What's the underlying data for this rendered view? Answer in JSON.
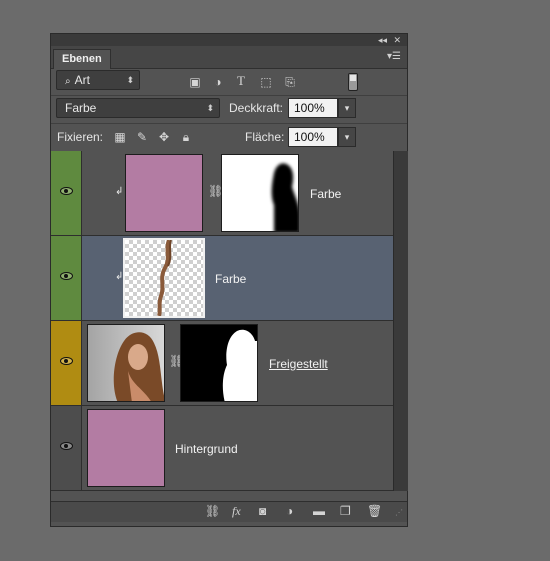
{
  "panel": {
    "tab_label": "Ebenen",
    "collapse_icon": "collapse-icon",
    "close_icon": "close-icon",
    "menu_icon": "panel-menu-icon"
  },
  "filter": {
    "kind_label": "Art",
    "icons": [
      "image-filter-icon",
      "adjustment-filter-icon",
      "type-filter-icon",
      "shape-filter-icon",
      "smartobject-filter-icon"
    ],
    "type_glyph": "T"
  },
  "blend": {
    "mode": "Farbe",
    "opacity_label": "Deckkraft:",
    "opacity_value": "100%"
  },
  "lock": {
    "label": "Fixieren:",
    "fill_label": "Fläche:",
    "fill_value": "100%"
  },
  "layers": [
    {
      "name": "Farbe",
      "color_tag": "#5a8a3a",
      "visible": true,
      "clipped": true,
      "thumb": "#b37ca3",
      "has_mask": true,
      "selected": false
    },
    {
      "name": "Farbe",
      "color_tag": "#5a8a3a",
      "visible": true,
      "clipped": true,
      "thumb": "transparent",
      "has_mask": false,
      "selected": true
    },
    {
      "name": "Freigestellt",
      "color_tag": "#a88a12",
      "visible": true,
      "clipped": false,
      "thumb": "photo",
      "has_mask": true,
      "selected": false
    },
    {
      "name": "Hintergrund",
      "color_tag": "#4a4a4a",
      "visible": true,
      "clipped": false,
      "thumb": "#b37ca3",
      "has_mask": false,
      "selected": false
    }
  ],
  "bottom_bar": {
    "fx_label": "fx",
    "icons": [
      "link-layers-icon",
      "fx-icon",
      "mask-icon",
      "adjustment-icon",
      "folder-icon",
      "new-layer-icon",
      "trash-icon"
    ]
  }
}
